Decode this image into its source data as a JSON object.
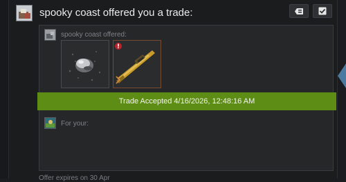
{
  "header": {
    "title": "spooky coast offered you a trade:"
  },
  "offer": {
    "offered_label": "spooky coast offered:",
    "items": [
      {
        "name": "rock-sphere-item-icon"
      },
      {
        "name": "golden-rifle-item-icon",
        "badge": "!"
      }
    ]
  },
  "status": {
    "accepted_text": "Trade Accepted 4/16/2026, 12:48:16 AM"
  },
  "for_you": {
    "label": "For your:"
  },
  "footer": {
    "note": "Offer expires on 30 Apr"
  },
  "colors": {
    "accepted_banner": "#5e8d15",
    "page_background": "#1b1c1e",
    "card_background": "#262729",
    "strange_quality_border": "#7a4a30"
  },
  "icons": {
    "decline": "ignore-tag-icon",
    "accept": "checkmark-icon"
  }
}
